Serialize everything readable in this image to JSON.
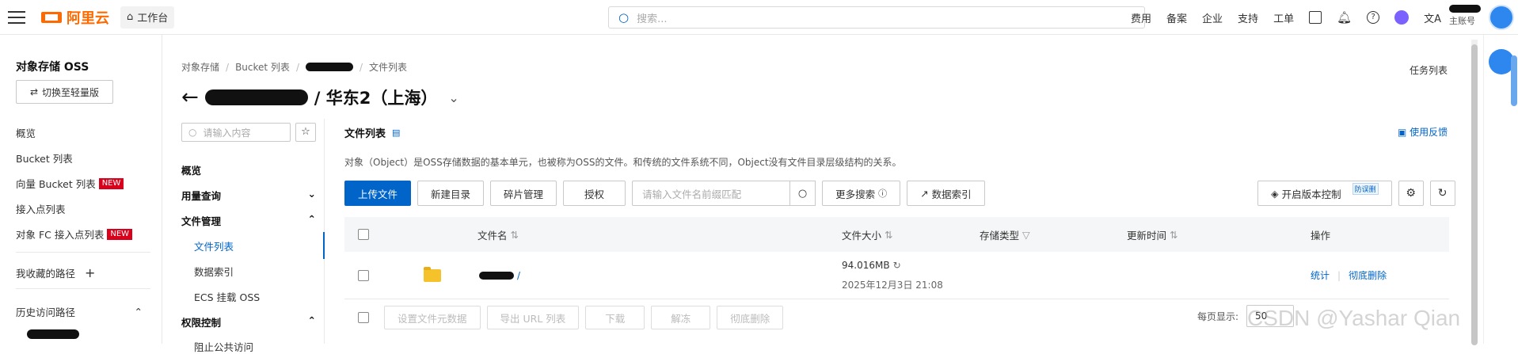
{
  "topbar": {
    "logo_text": "阿里云",
    "workspace_label": "工作台",
    "search_placeholder": "搜索...",
    "nav": [
      "费用",
      "备案",
      "企业",
      "支持",
      "工单"
    ],
    "account_label": "主账号"
  },
  "sidebar": {
    "title": "对象存储 OSS",
    "switch_label": "切换至轻量版",
    "items": [
      {
        "label": "概览"
      },
      {
        "label": "Bucket 列表"
      },
      {
        "label": "向量 Bucket 列表",
        "badge": "NEW"
      },
      {
        "label": "接入点列表"
      },
      {
        "label": "对象 FC 接入点列表",
        "badge": "NEW"
      }
    ],
    "favorites_label": "我收藏的路径",
    "history_label": "历史访问路径"
  },
  "breadcrumb": {
    "items": [
      "对象存储",
      "Bucket 列表",
      "文件列表"
    ]
  },
  "task_list_label": "任务列表",
  "page_title": {
    "region": "/ 华东2（上海）"
  },
  "file_panel": {
    "search_placeholder": "请输入内容",
    "items": [
      {
        "label": "概览",
        "level": 0
      },
      {
        "label": "用量查询",
        "level": 0,
        "arrow": "⌄"
      },
      {
        "label": "文件管理",
        "level": 0,
        "arrow": "⌃"
      },
      {
        "label": "文件列表",
        "level": 1,
        "active": true
      },
      {
        "label": "数据索引",
        "level": 1
      },
      {
        "label": "ECS 挂载 OSS",
        "level": 1
      },
      {
        "label": "权限控制",
        "level": 0,
        "arrow": "⌃"
      },
      {
        "label": "阻止公共访问",
        "level": 1
      }
    ]
  },
  "main": {
    "section_title": "文件列表",
    "feedback_label": "使用反馈",
    "description": "对象（Object）是OSS存储数据的基本单元，也被称为OSS的文件。和传统的文件系统不同，Object没有文件目录层级结构的关系。",
    "toolbar": {
      "upload": "上传文件",
      "new_dir": "新建目录",
      "fragments": "碎片管理",
      "authorize": "授权",
      "search_placeholder": "请输入文件名前缀匹配",
      "more_search": "更多搜索",
      "data_index": "数据索引",
      "versioning": "开启版本控制",
      "anti_leech": "防误删"
    },
    "table": {
      "headers": {
        "name": "文件名",
        "size": "文件大小",
        "storage_type": "存储类型",
        "updated": "更新时间",
        "actions": "操作"
      },
      "rows": [
        {
          "name_suffix": "/",
          "size": "94.016MB",
          "updated": "2025年12月3日 21:08",
          "action_stats": "统计",
          "action_delete": "彻底删除"
        }
      ]
    },
    "footer": {
      "set_meta": "设置文件元数据",
      "export_url": "导出 URL 列表",
      "download": "下载",
      "unfreeze": "解冻",
      "delete": "彻底删除",
      "per_page_label": "每页显示:",
      "per_page_value": "50"
    }
  },
  "watermark": "CSDN @Yashar Qian",
  "colors": {
    "brand": "#ff6a00",
    "primary": "#0064c8",
    "badge_new": "#d9001b"
  }
}
